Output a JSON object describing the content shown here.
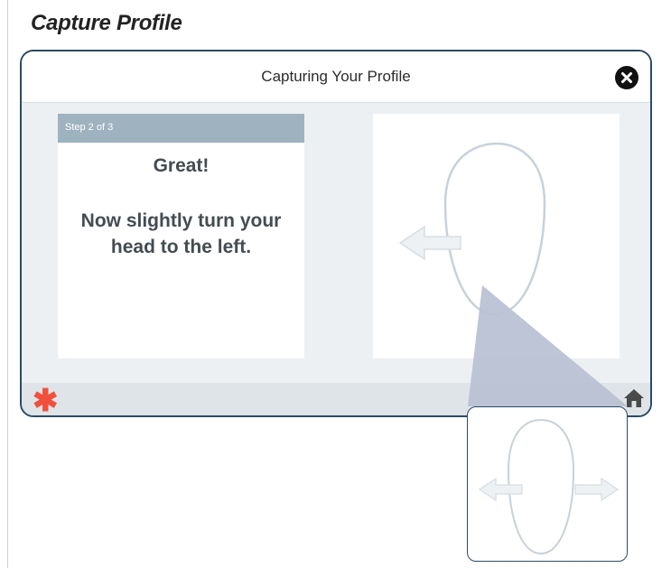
{
  "page": {
    "heading": "Capture Profile"
  },
  "dialog": {
    "title": "Capturing Your Profile",
    "close_icon": "close-circle-icon",
    "step": {
      "label": "Step 2 of 3",
      "headline": "Great!",
      "instruction": "Now slightly turn your head to the left."
    },
    "illustration": {
      "outline_icon": "face-outline-icon",
      "direction_icon": "arrow-left-icon"
    },
    "footer": {
      "logo_icon": "asterisk-logo-icon",
      "home_icon": "home-icon"
    }
  },
  "zoom_callout": {
    "outline_icon": "face-outline-icon",
    "arrows": [
      "arrow-left-icon",
      "arrow-right-icon"
    ]
  },
  "colors": {
    "frame_border": "#2b4a66",
    "step_bar": "#9fb2bf",
    "brand_asterisk": "#f0503c",
    "callout": "#b9c0d2"
  }
}
